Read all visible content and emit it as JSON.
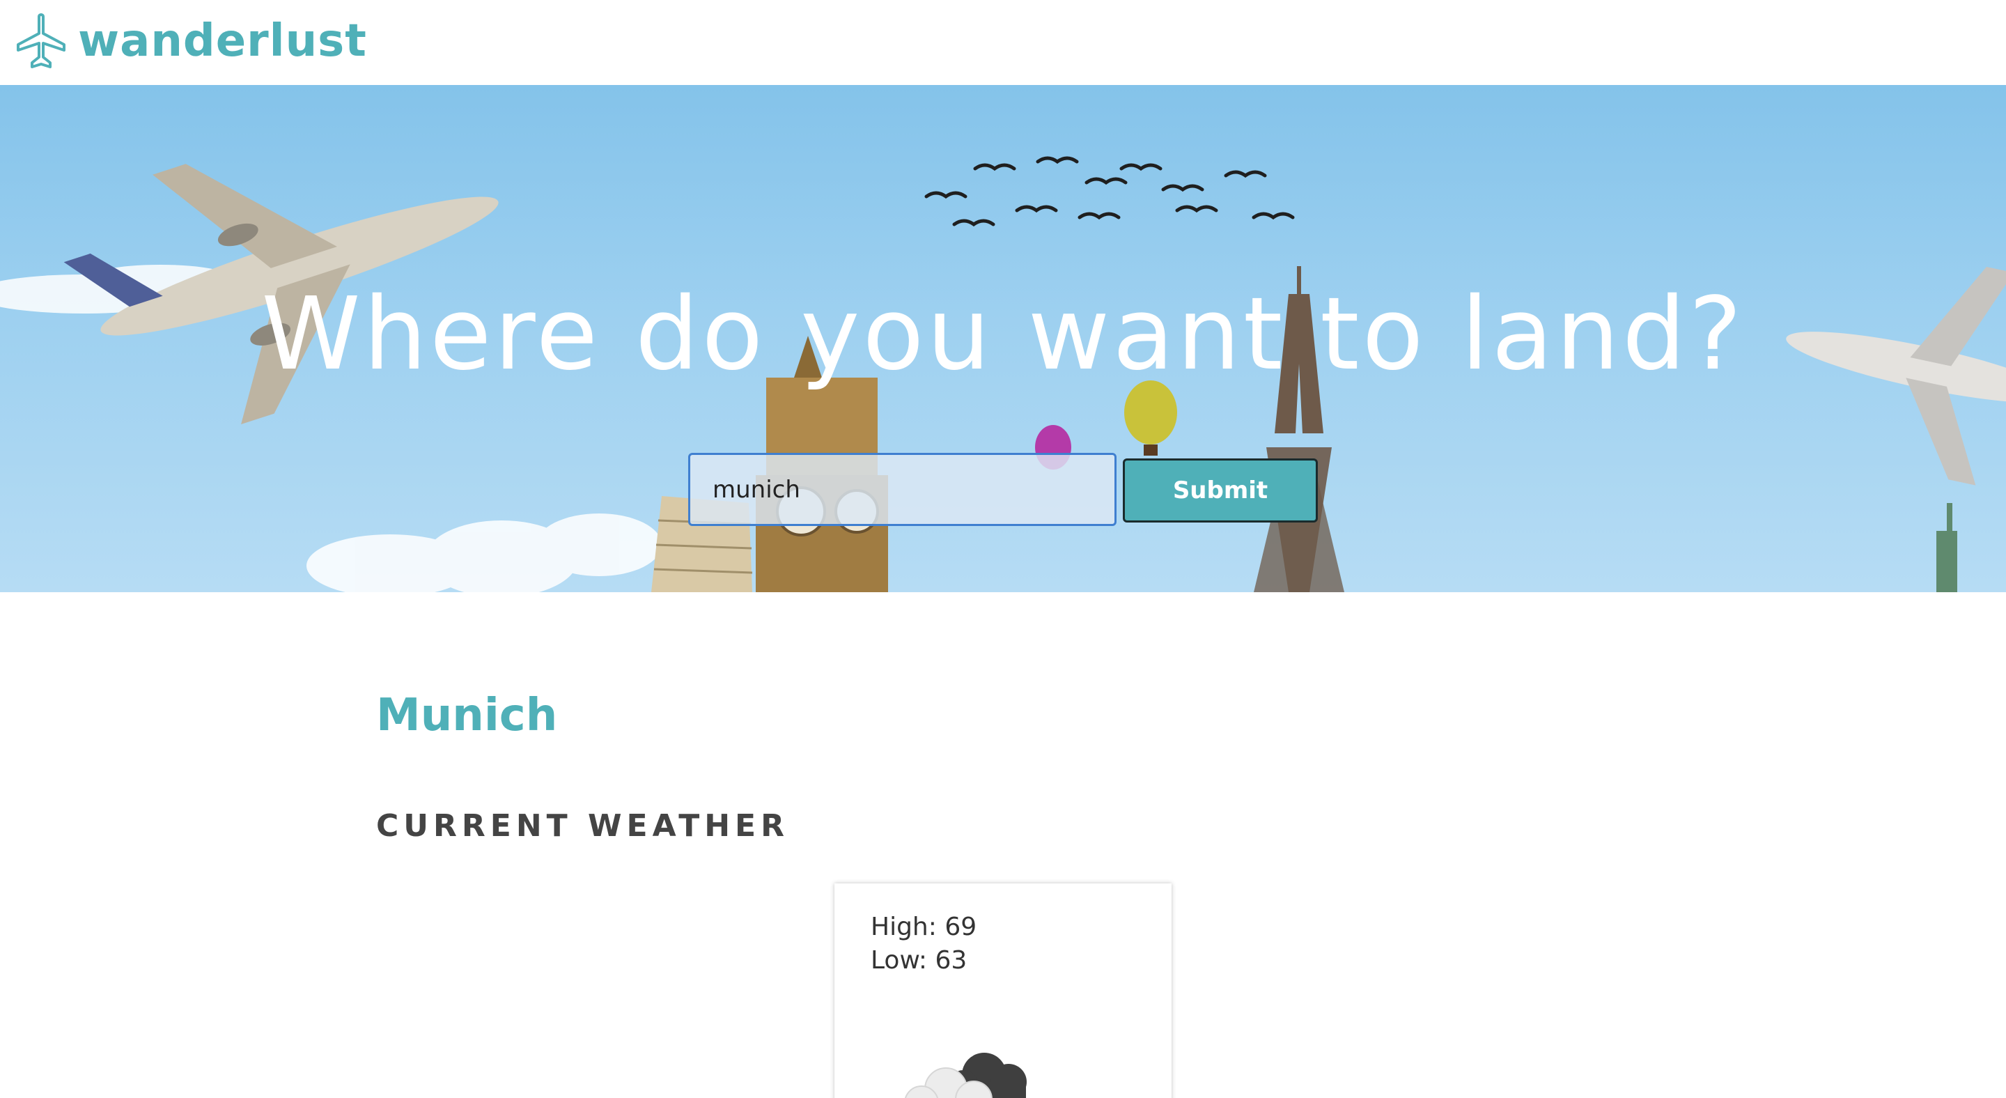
{
  "header": {
    "brand": "wanderlust",
    "logo_icon": "airplane-icon",
    "brand_color": "#4fb0b8"
  },
  "hero": {
    "title": "Where do you want to land?",
    "search": {
      "value": "munich",
      "placeholder": ""
    },
    "submit_label": "Submit"
  },
  "result": {
    "city": "Munich",
    "section_title": "CURRENT WEATHER",
    "weather": {
      "high_text": "High: 69",
      "low_text": "Low: 63",
      "icon": "cloudy-icon"
    }
  },
  "colors": {
    "accent": "#4fb0b8",
    "sky": "#8fcbed",
    "input_border": "#3f7fd0"
  }
}
